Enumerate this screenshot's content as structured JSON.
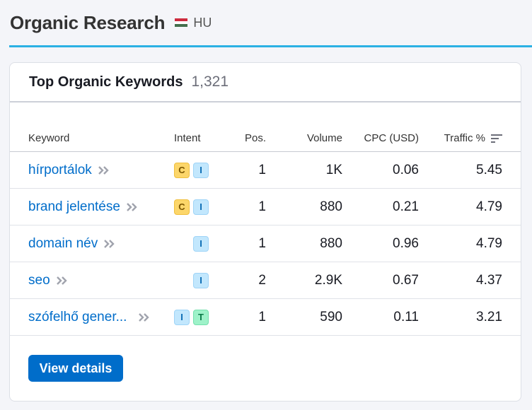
{
  "header": {
    "title": "Organic Research",
    "database": "HU",
    "flag_colors": [
      "#cd2a3e",
      "#ffffff",
      "#436f4d"
    ]
  },
  "card": {
    "title": "Top Organic Keywords",
    "count": "1,321",
    "columns": {
      "keyword": "Keyword",
      "intent": "Intent",
      "pos": "Pos.",
      "volume": "Volume",
      "cpc": "CPC (USD)",
      "traffic": "Traffic %"
    },
    "rows": [
      {
        "keyword": "hírportálok",
        "intents": [
          "C",
          "I"
        ],
        "pos": "1",
        "volume": "1K",
        "cpc": "0.06",
        "traffic": "5.45"
      },
      {
        "keyword": "brand jelentése",
        "intents": [
          "C",
          "I"
        ],
        "pos": "1",
        "volume": "880",
        "cpc": "0.21",
        "traffic": "4.79"
      },
      {
        "keyword": "domain név",
        "intents": [
          "",
          "I"
        ],
        "pos": "1",
        "volume": "880",
        "cpc": "0.96",
        "traffic": "4.79"
      },
      {
        "keyword": "seo",
        "intents": [
          "",
          "I"
        ],
        "pos": "2",
        "volume": "2.9K",
        "cpc": "0.67",
        "traffic": "4.37"
      },
      {
        "keyword": "szófelhő gener...",
        "intents": [
          "I",
          "T"
        ],
        "pos": "1",
        "volume": "590",
        "cpc": "0.11",
        "traffic": "3.21"
      }
    ],
    "button_label": "View details"
  },
  "intent_colors": {
    "C": {
      "bg": "#fcd66a",
      "fg": "#7a5500",
      "border": "#f0bf3e"
    },
    "I": {
      "bg": "#c2e7fd",
      "fg": "#0a6bb3",
      "border": "#9fd4f7"
    },
    "T": {
      "bg": "#9ef2c9",
      "fg": "#0b7a48",
      "border": "#74e0ad"
    }
  },
  "icons": {
    "keyword_chevron": "double-chevron-right-icon",
    "traffic_sort": "sort-descending-icon"
  }
}
